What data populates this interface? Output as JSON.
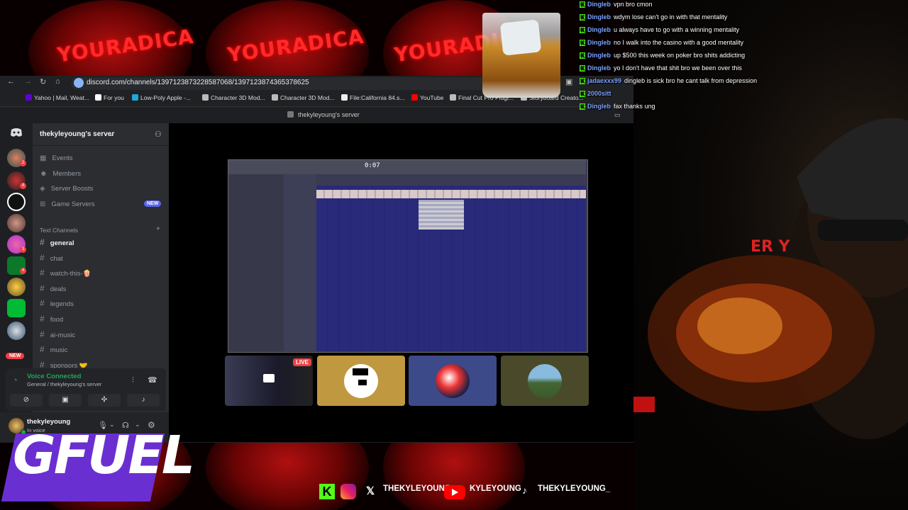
{
  "overlay": {
    "blob_text": "YOURADICA",
    "brand": "GFUEL"
  },
  "browser": {
    "url": "discord.com/channels/1397123873228587068/1397123874365378625",
    "bookmarks": [
      {
        "label": "Yahoo | Mail, Weat...",
        "color": "#6001d2"
      },
      {
        "label": "For you",
        "color": "#ffffff"
      },
      {
        "label": "Low-Poly Apple -...",
        "color": "#1caad9"
      },
      {
        "label": "Character 3D Mod...",
        "color": "#bbbbbb"
      },
      {
        "label": "Character 3D Mod...",
        "color": "#bbbbbb"
      },
      {
        "label": "File:California 84.s...",
        "color": "#eeeeee"
      },
      {
        "label": "YouTube",
        "color": "#ff0000"
      },
      {
        "label": "Final Cut Pro Plugi...",
        "color": "#bbbbbb"
      },
      {
        "label": "Storyboard Creato...",
        "color": "#bbbbbb"
      }
    ]
  },
  "discord": {
    "window_title": "thekyleyoung's server",
    "server_name": "thekyleyoung's server",
    "top_items": [
      {
        "label": "Events",
        "icon": "calendar-icon"
      },
      {
        "label": "Members",
        "icon": "members-icon"
      },
      {
        "label": "Server Boosts",
        "icon": "boost-icon"
      },
      {
        "label": "Game Servers",
        "icon": "gamepad-icon"
      }
    ],
    "new_badge": "NEW",
    "section_label": "Text Channels",
    "channels": [
      "general",
      "chat",
      "watch-this-🍿",
      "deals",
      "legends",
      "food",
      "ai-music",
      "music",
      "sponsors 🤝"
    ],
    "active_channel": "general",
    "guild_new_badge": "NEW",
    "guild_badges": [
      "2",
      "4",
      "3",
      "4"
    ],
    "voice": {
      "status": "Voice Connected",
      "detail": "General / thekyleyoung's server"
    },
    "user": {
      "name": "thekyleyoung",
      "status": "In voice"
    },
    "stream": {
      "live_badge": "LIVE",
      "time": "0:07"
    }
  },
  "chat": [
    {
      "name": "Dingleb",
      "text": "vpn bro cmon"
    },
    {
      "name": "Dingleb",
      "text": "wdym lose can't go in with that mentality"
    },
    {
      "name": "Dingleb",
      "text": "u always have to go with a winning mentality"
    },
    {
      "name": "Dingleb",
      "text": "no I walk into the casino with a good mentality"
    },
    {
      "name": "Dingleb",
      "text": "up $500 this week on poker bro shits addicting"
    },
    {
      "name": "Dingleb",
      "text": "yo I don't have that shit bro we been over this"
    },
    {
      "name": "jadaexxx99",
      "text": "dingleb is sick bro he cant talk from depression"
    },
    {
      "name": "2000sitt",
      "text": ""
    },
    {
      "name": "Dingleb",
      "text": "fax thanks ung"
    }
  ],
  "socials": {
    "x_handle": "THEKYLEYOUNG",
    "youtube_handle": "KYLEYOUNG",
    "tiktok_handle": "THEKYLEYOUNG_"
  }
}
